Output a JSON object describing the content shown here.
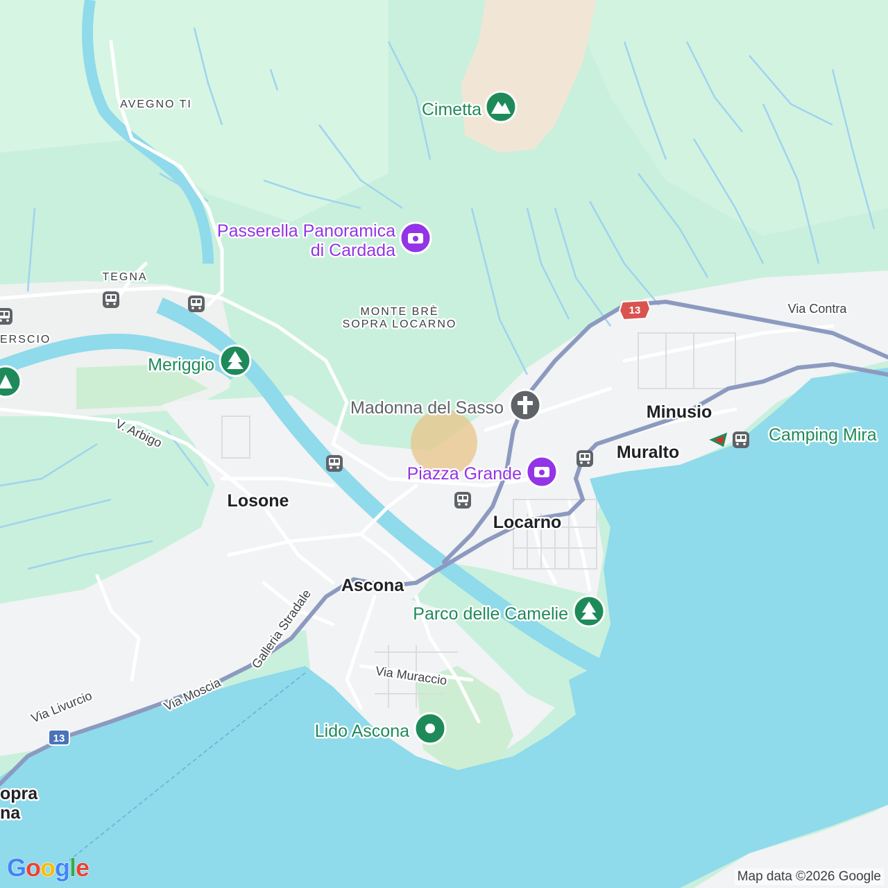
{
  "map": {
    "colors": {
      "water": "#8fdaeb",
      "forest": "#c9f0dc",
      "urban": "#f1f3f4",
      "park": "#cdeed2",
      "rock": "#f1e6d5",
      "road": "#8c9ac0",
      "road_minor": "#ffffff",
      "stream": "#9fd3ef",
      "poi_green": "#1e8a5a",
      "poi_purple": "#9334e6",
      "shield": "#d9534f",
      "highlight": "#e8c48a"
    },
    "labels": {
      "cimetta": "Cimetta",
      "avegno": "AVEGNO TI",
      "passerella_1": "Passerella Panoramica",
      "passerella_2": "di Cardada",
      "tegna": "TEGNA",
      "monte_bre_1": "MONTE BRÈ",
      "monte_bre_2": "SOPRA LOCARNO",
      "verscio": "ERSCIO",
      "meriggio": "Meriggio",
      "madonna": "Madonna del Sasso",
      "v_arbigo": "V. Arbigo",
      "losone": "Losone",
      "piazza_grande": "Piazza Grande",
      "locarno": "Locarno",
      "minusio": "Minusio",
      "muralto": "Muralto",
      "camping": "Camping Mira",
      "via_contra": "Via Contra",
      "ascona": "Ascona",
      "parco_camelie": "Parco delle Camelie",
      "galleria": "Galleria Stradale",
      "via_muraccio": "Via Muraccio",
      "via_moscia": "Via Moscia",
      "via_livurcio": "Via Livurcio",
      "lido_ascona": "Lido Ascona",
      "ronco_1": "opra",
      "ronco_2": "na"
    },
    "shields": {
      "route_13_top": "13",
      "route_13_bottom": "13"
    },
    "icons": {
      "cimetta": "mountain-icon",
      "passerella": "camera-icon",
      "meriggio": "tree-icon",
      "madonna": "church-icon",
      "piazza": "camera-icon",
      "parco": "tree-icon",
      "lido": "pin-icon",
      "train": "train-icon",
      "camping": "camping-icon"
    }
  },
  "attribution": "Map data ©2026 Google",
  "logo": {
    "letters": [
      "G",
      "o",
      "o",
      "g",
      "l",
      "e"
    ],
    "colors": [
      "#4285F4",
      "#EA4335",
      "#FBBC05",
      "#4285F4",
      "#34A853",
      "#EA4335"
    ]
  }
}
